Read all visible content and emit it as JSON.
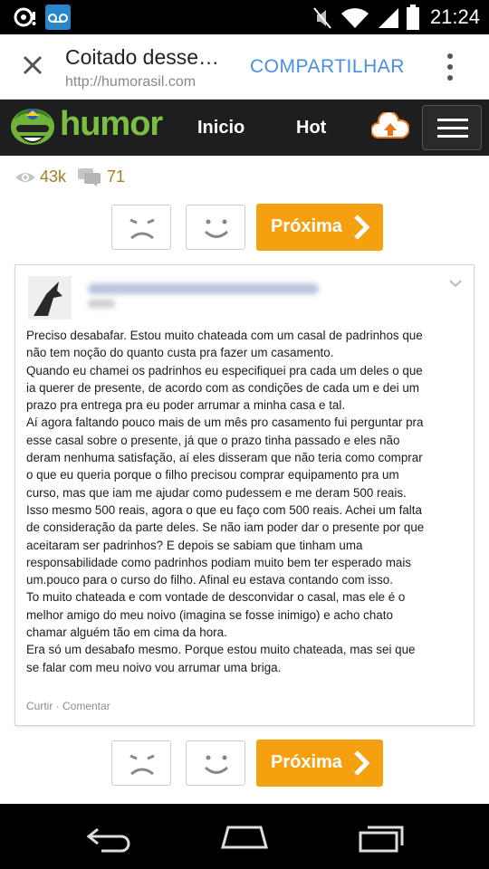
{
  "status_bar": {
    "time": "21:24",
    "left_icons": [
      "camera-icon",
      "voicemail-icon"
    ],
    "right_icons": [
      "mute-icon",
      "wifi-icon",
      "signal-icon",
      "battery-icon"
    ]
  },
  "chrome_bar": {
    "close_icon": "close-icon",
    "title": "Coitado desse…",
    "url": "http://humorasil.com",
    "share_label": "COMPARTILHAR",
    "menu_icon": "kebab-menu-icon"
  },
  "site_header": {
    "logo_text": "humor",
    "nav": {
      "inicio": "Inicio",
      "hot": "Hot"
    },
    "upload_icon": "cloud-upload-icon",
    "menu_icon": "hamburger-icon"
  },
  "stats": {
    "views": "43k",
    "comments": "71"
  },
  "vote_top": {
    "next_label": "Próxima"
  },
  "post": {
    "lines": [
      "Preciso desabafar. Estou muito chateada com um casal de padrinhos que",
      "não tem noção do quanto custa pra fazer um casamento.",
      "Quando eu chamei os padrinhos eu especifiquei pra cada um deles o que",
      "ia querer de presente, de acordo com as condições de cada um e dei um",
      "prazo pra entrega pra eu poder arrumar a minha casa e tal.",
      "Aí agora faltando pouco mais de um mês pro casamento fui perguntar pra",
      "esse casal sobre o presente, já que o prazo tinha passado e eles não",
      "deram nenhuma satisfação, aí eles disseram que não teria como comprar",
      "o que eu queria porque o filho precisou comprar equipamento pra um",
      "curso, mas que iam me ajudar como pudessem e me deram 500 reais.",
      "Isso mesmo 500 reais, agora o que eu faço com 500 reais. Achei um falta",
      "de consideração da parte deles. Se não iam poder dar o presente por que",
      "aceitaram ser padrinhos? E depois se sabiam que tinham uma",
      "responsabilidade como padrinhos podiam muito bem ter esperado mais",
      "um.pouco para o curso do filho. Afinal eu estava contando com isso.",
      "To muito chateada e com vontade de desconvidar o casal, mas ele é o",
      "melhor amigo do meu noivo (imagina se fosse inimigo) e acho chato",
      "chamar alguém tão em cima da hora.",
      "Era só um desabafo mesmo. Porque estou muito chateada, mas sei que",
      "se falar com meu noivo vou arrumar uma briga."
    ],
    "actions": "Curtir · Comentar"
  },
  "vote_bottom": {
    "next_label": "Próxima"
  },
  "nav_bar": {
    "icons": [
      "back-icon",
      "home-icon",
      "recents-icon"
    ]
  },
  "colors": {
    "accent": "#f5a00f",
    "logo_green": "#7bc043",
    "share_blue": "#4a8fe0",
    "stats": "#a67c1f"
  }
}
